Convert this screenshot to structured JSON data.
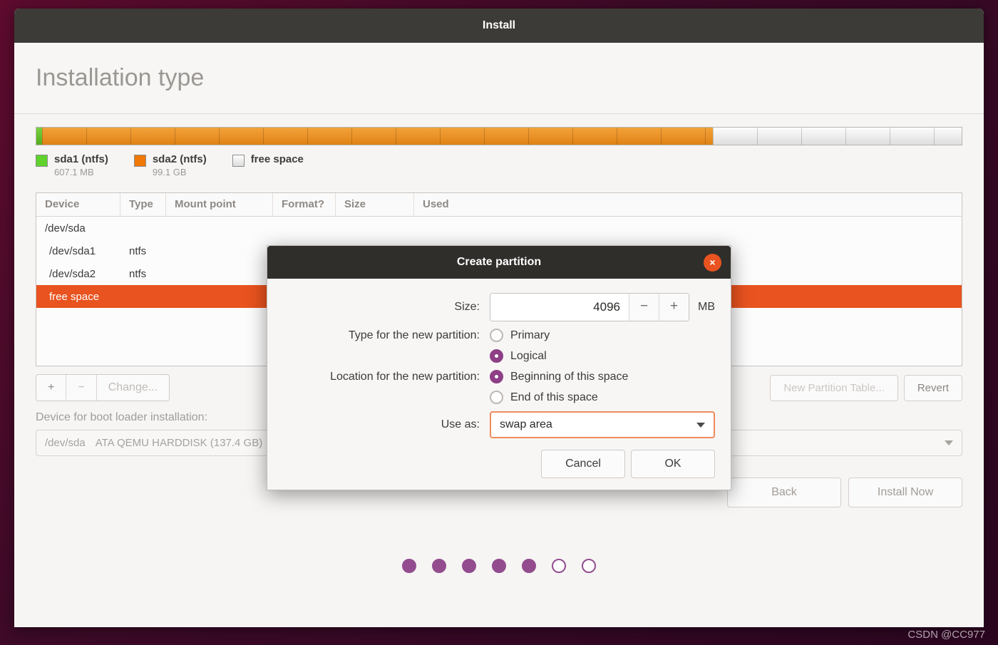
{
  "window": {
    "title": "Install",
    "page_heading": "Installation type"
  },
  "partition_bar": {
    "segments": [
      {
        "name": "sda1",
        "color": "#5fd32b",
        "width_pct": 0.6
      },
      {
        "name": "sda2",
        "color": "#f07807",
        "width_pct": 72.5
      },
      {
        "name": "free space",
        "color": "#e0e0e0",
        "width_pct": 26.9
      }
    ]
  },
  "legend": [
    {
      "label": "sda1 (ntfs)",
      "size": "607.1 MB",
      "swatch": "green"
    },
    {
      "label": "sda2 (ntfs)",
      "size": "99.1 GB",
      "swatch": "orange"
    },
    {
      "label": "free space",
      "size": "",
      "swatch": "freesp"
    }
  ],
  "table": {
    "headers": [
      "Device",
      "Type",
      "Mount point",
      "Format?",
      "Size",
      "Used"
    ],
    "rows": [
      {
        "device": "/dev/sda",
        "type": "",
        "mount": "",
        "format": "",
        "size": "",
        "used": "",
        "indent": false,
        "selected": false
      },
      {
        "device": "/dev/sda1",
        "type": "ntfs",
        "mount": "",
        "format": "",
        "size": "",
        "used": "",
        "indent": true,
        "selected": false
      },
      {
        "device": "/dev/sda2",
        "type": "ntfs",
        "mount": "",
        "format": "",
        "size": "",
        "used": "",
        "indent": true,
        "selected": false
      },
      {
        "device": "free space",
        "type": "",
        "mount": "",
        "format": "",
        "size": "",
        "used": "",
        "indent": true,
        "selected": true
      }
    ]
  },
  "toolbar": {
    "add_label": "+",
    "remove_label": "−",
    "change_label": "Change...",
    "new_partition_table_label": "New Partition Table...",
    "revert_label": "Revert"
  },
  "bootloader": {
    "label": "Device for boot loader installation:",
    "device": "/dev/sda",
    "description": "ATA QEMU HARDDISK (137.4 GB)"
  },
  "navigation": {
    "back_label": "Back",
    "install_label": "Install Now"
  },
  "progress_dots": {
    "total": 7,
    "filled": 5
  },
  "dialog": {
    "title": "Create partition",
    "close_icon": "×",
    "size_label": "Size:",
    "size_value": "4096",
    "size_decrement": "−",
    "size_increment": "+",
    "size_unit": "MB",
    "type_label": "Type for the new partition:",
    "type_options": [
      {
        "label": "Primary",
        "selected": false
      },
      {
        "label": "Logical",
        "selected": true
      }
    ],
    "location_label": "Location for the new partition:",
    "location_options": [
      {
        "label": "Beginning of this space",
        "selected": true
      },
      {
        "label": "End of this space",
        "selected": false
      }
    ],
    "use_as_label": "Use as:",
    "use_as_value": "swap area",
    "cancel_label": "Cancel",
    "ok_label": "OK"
  },
  "watermark": "CSDN @CC977",
  "colors": {
    "accent_orange": "#e8531f",
    "ubuntu_purple": "#934d8f",
    "titlebar": "#3c3b37",
    "dialog_titlebar": "#2f2e2b"
  }
}
